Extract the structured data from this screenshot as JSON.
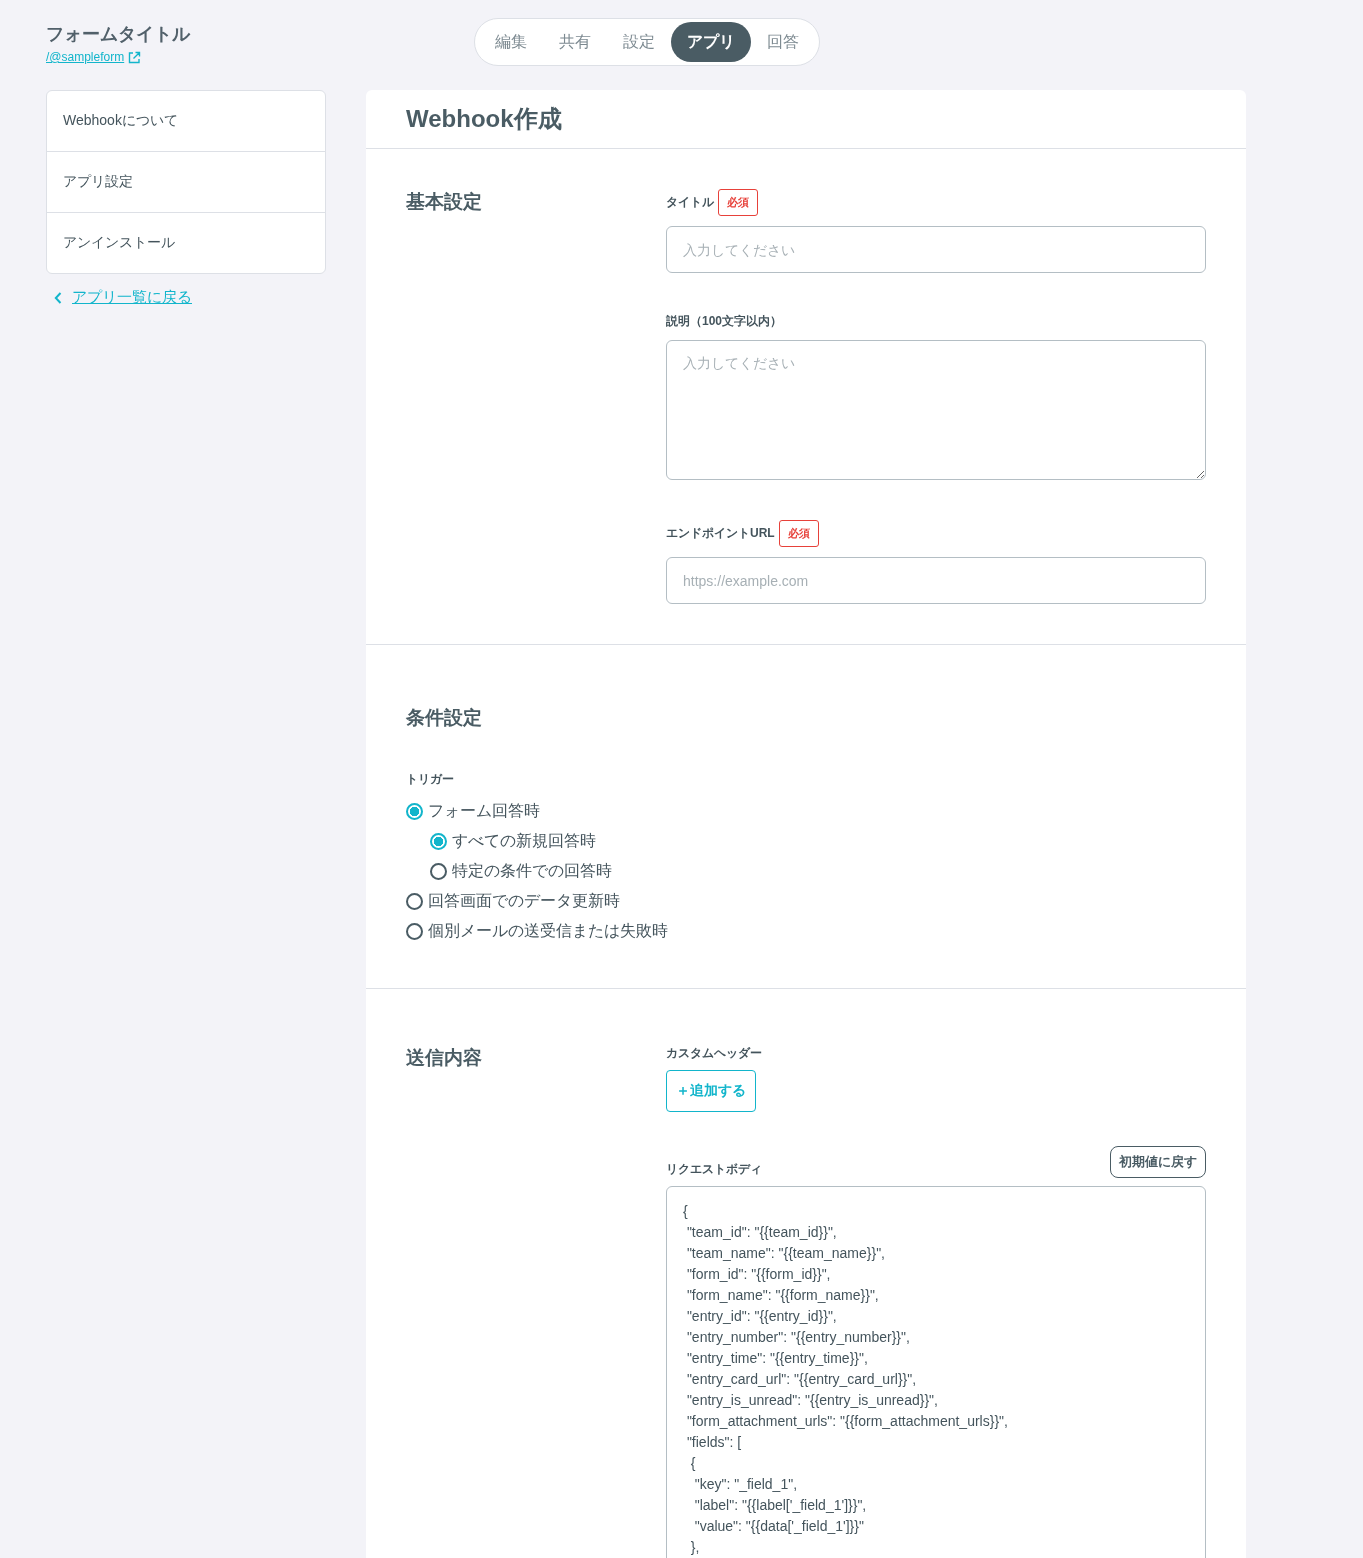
{
  "form": {
    "title": "フォームタイトル",
    "link": "/@sampleform"
  },
  "tabs": [
    {
      "label": "編集",
      "selected": false
    },
    {
      "label": "共有",
      "selected": false
    },
    {
      "label": "設定",
      "selected": false
    },
    {
      "label": "アプリ",
      "selected": true
    },
    {
      "label": "回答",
      "selected": false
    }
  ],
  "sidebar": {
    "items": [
      "Webhookについて",
      "アプリ設定",
      "アンインストール"
    ],
    "back_link": "アプリ一覧に戻る"
  },
  "page_title": "Webhook作成",
  "basic": {
    "heading": "基本設定",
    "fields": [
      {
        "kind": "input",
        "label": "タイトル",
        "required": true,
        "required_badge": "必須",
        "placeholder": "入力してください"
      },
      {
        "kind": "textarea",
        "label": "説明（100文字以内）",
        "required": false,
        "placeholder": "入力してください"
      },
      {
        "kind": "input",
        "label": "エンドポイントURL",
        "required": true,
        "required_badge": "必須",
        "placeholder": "https://example.com"
      }
    ]
  },
  "conditions": {
    "heading": "条件設定",
    "trigger_label": "トリガー",
    "options": [
      {
        "label": "フォーム回答時",
        "selected": true,
        "children": [
          {
            "label": "すべての新規回答時",
            "selected": true
          },
          {
            "label": "特定の条件での回答時",
            "selected": false
          }
        ]
      },
      {
        "label": "回答画面でのデータ更新時",
        "selected": false
      },
      {
        "label": "個別メールの送受信または失敗時",
        "selected": false
      }
    ]
  },
  "payload": {
    "heading": "送信内容",
    "custom_header_label": "カスタムヘッダー",
    "add_button": "＋追加する",
    "body_label": "リクエストボディ",
    "reset_button": "初期値に戻す",
    "body_lines": [
      "{",
      " \"team_id\": \"{{team_id}}\",",
      " \"team_name\": \"{{team_name}}\",",
      " \"form_id\": \"{{form_id}}\",",
      " \"form_name\": \"{{form_name}}\",",
      " \"entry_id\": \"{{entry_id}}\",",
      " \"entry_number\": \"{{entry_number}}\",",
      " \"entry_time\": \"{{entry_time}}\",",
      " \"entry_card_url\": \"{{entry_card_url}}\",",
      " \"entry_is_unread\": \"{{entry_is_unread}}\",",
      " \"form_attachment_urls\": \"{{form_attachment_urls}}\",",
      " \"fields\": [",
      "  {",
      "   \"key\": \"_field_1\",",
      "   \"label\": \"{{label['_field_1']}}\",",
      "   \"value\": \"{{data['_field_1']}}\"",
      "  },"
    ]
  }
}
